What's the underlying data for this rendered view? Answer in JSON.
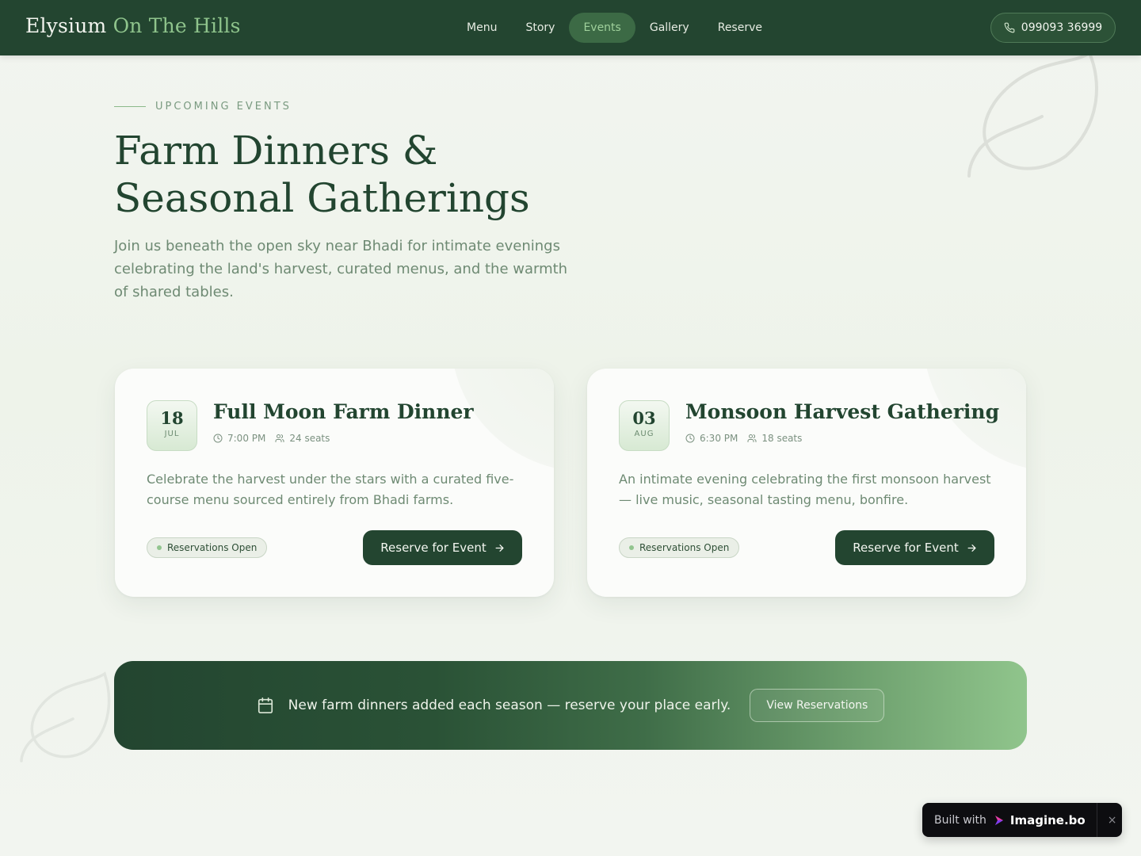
{
  "nav": {
    "brand_main": "Elysium",
    "brand_accent": "On The Hills",
    "links": [
      {
        "label": "Menu"
      },
      {
        "label": "Story"
      },
      {
        "label": "Events"
      },
      {
        "label": "Gallery"
      },
      {
        "label": "Reserve"
      }
    ],
    "active_link": "Events",
    "phone": "099093 36999"
  },
  "hero": {
    "eyebrow": "UPCOMING EVENTS",
    "title_line1": "Farm Dinners &",
    "title_line2": "Seasonal Gatherings",
    "subtitle": "Join us beneath the open sky near Bhadi for intimate evenings celebrating the land's harvest, curated menus, and the warmth of shared tables."
  },
  "events": [
    {
      "day": "18",
      "month": "JUL",
      "title": "Full Moon Farm Dinner",
      "time": "7:00 PM",
      "seats": "24 seats",
      "description": "Celebrate the harvest under the stars with a curated five-course menu sourced entirely from Bhadi farms.",
      "status": "Reservations Open",
      "cta": "Reserve for Event"
    },
    {
      "day": "03",
      "month": "AUG",
      "title": "Monsoon Harvest Gathering",
      "time": "6:30 PM",
      "seats": "18 seats",
      "description": "An intimate evening celebrating the first monsoon harvest — live music, seasonal tasting menu, bonfire.",
      "status": "Reservations Open",
      "cta": "Reserve for Event"
    }
  ],
  "banner": {
    "text": "New farm dinners added each season — reserve your place early.",
    "button": "View Reservations"
  },
  "built_with": {
    "label": "Built with",
    "brand": "Imagine.bo",
    "close": "×"
  },
  "colors": {
    "nav_bg": "#234530",
    "accent_green": "#8fc48c",
    "active_pill": "#3c6a45",
    "button_dark": "#234530",
    "text_muted": "#6e8a73"
  },
  "icons": {
    "phone": "phone-icon",
    "clock": "clock-icon",
    "seats": "users-icon",
    "arrow": "arrow-right-icon",
    "calendar": "calendar-icon",
    "close": "close-icon"
  }
}
